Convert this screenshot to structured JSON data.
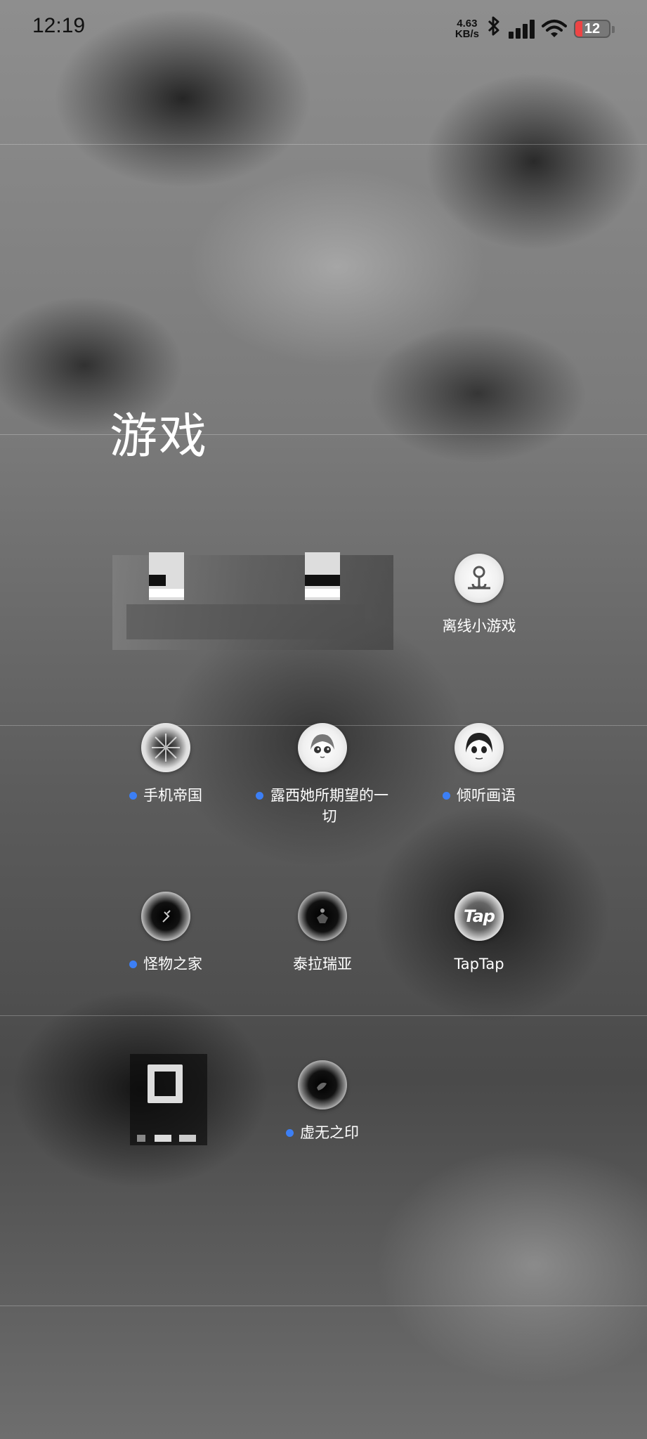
{
  "status_bar": {
    "time": "12:19",
    "net_speed_value": "4.63",
    "net_speed_unit": "KB/s",
    "battery_level": "12",
    "icons": [
      "bluetooth-icon",
      "signal-icon",
      "wifi-icon",
      "battery-icon"
    ]
  },
  "folder": {
    "title": "游戏"
  },
  "apps": [
    {
      "label": "离线小游戏",
      "icon": "offline-games-icon",
      "new": false
    },
    {
      "label": "手机帝国",
      "icon": "mobile-empire-icon",
      "new": true
    },
    {
      "label": "露西她所期望的一切",
      "icon": "lucy-icon",
      "new": true
    },
    {
      "label": "倾听画语",
      "icon": "listen-painting-icon",
      "new": true
    },
    {
      "label": "怪物之家",
      "icon": "monster-home-icon",
      "new": true
    },
    {
      "label": "泰拉瑞亚",
      "icon": "terraria-icon",
      "new": false
    },
    {
      "label": "TapTap",
      "icon": "taptap-icon",
      "new": false
    },
    {
      "label": "虚无之印",
      "icon": "void-seal-icon",
      "new": true
    }
  ],
  "colors": {
    "new_dot": "#3c7ff5",
    "text": "#ffffff",
    "status_text": "#111111",
    "battery_low": "#ee4444"
  }
}
